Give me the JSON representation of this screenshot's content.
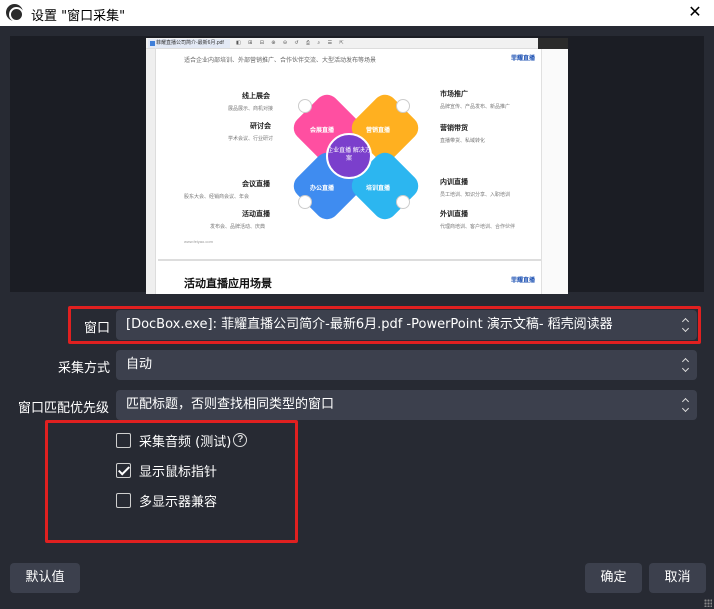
{
  "window": {
    "title": "设置 \"窗口采集\"",
    "close_glyph": "✕"
  },
  "preview": {
    "tab_label": "菲耀直播公司简介-最新6月.pdf",
    "toolbar_glyphs": "◧ ⊞ ⊟ ⊕ ⊖ ↺ ⎙ ⌕ ☰ ⇱",
    "page_header": "适合企业内部培训、外部营销推广、合作伙伴交流、大型活动发布等场景",
    "logo": "菲耀直播",
    "center": "企业直播 解决方案",
    "petals": [
      "会展直播",
      "营销直播",
      "办公直播",
      "培训直播"
    ],
    "left_labels": [
      {
        "title": "线上展会",
        "desc": "展品展示、商机对接"
      },
      {
        "title": "研讨会",
        "desc": "学术会议、行业研讨"
      },
      {
        "title": "会议直播",
        "desc": "股东大会、经销商会议、年会"
      },
      {
        "title": "活动直播",
        "desc": "发布会、品牌活动、庆典"
      }
    ],
    "right_labels": [
      {
        "title": "市场推广",
        "desc": "品牌宣传、产品发布、新品推广"
      },
      {
        "title": "营销带货",
        "desc": "直播带货、私域转化"
      },
      {
        "title": "内训直播",
        "desc": "员工培训、知识分享、入职培训"
      },
      {
        "title": "外训直播",
        "desc": "代理商培训、客户培训、合作伙伴"
      }
    ],
    "site": "www.feiyao.com",
    "section_title": "活动直播应用场景"
  },
  "form": {
    "window_label": "窗口",
    "window_value": "[DocBox.exe]: 菲耀直播公司简介-最新6月.pdf -PowerPoint 演示文稿- 稻壳阅读器",
    "capture_method_label": "采集方式",
    "capture_method_value": "自动",
    "match_priority_label": "窗口匹配优先级",
    "match_priority_value": "匹配标题，否则查找相同类型的窗口"
  },
  "options": [
    {
      "label": "采集音频 (测试)",
      "checked": false,
      "help": true
    },
    {
      "label": "显示鼠标指针",
      "checked": true,
      "help": false
    },
    {
      "label": "多显示器兼容",
      "checked": false,
      "help": false
    }
  ],
  "help_glyph": "?",
  "buttons": {
    "defaults": "默认值",
    "ok": "确定",
    "cancel": "取消"
  },
  "colors": {
    "background": "#272a33",
    "control": "#3c404d",
    "highlight": "#e02020",
    "petal_pink": "#ff4fa1",
    "petal_orange": "#ffb020",
    "petal_blue": "#3f8cf0",
    "petal_cyan": "#2cb6f0",
    "center_purple": "#7b3fcc"
  }
}
